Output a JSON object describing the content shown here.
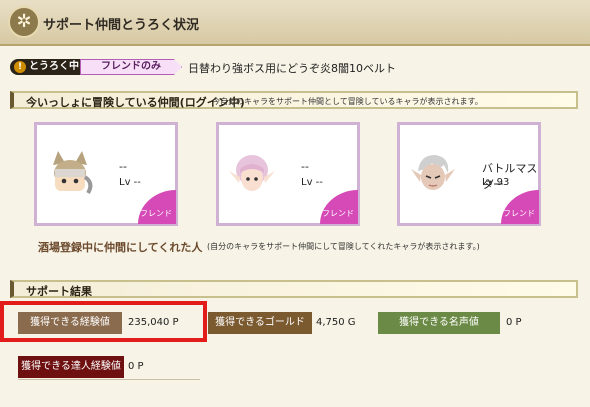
{
  "header": {
    "title": "サポート仲間とうろく状況"
  },
  "status": {
    "badge": "とうろく中",
    "badge_icon": "!",
    "friend_only": "フレンドのみ",
    "comment": "日替わり強ボス用にどうぞ炎8闇10ベルト"
  },
  "adventuring": {
    "title": "今いっしょに冒険している仲間(ログイン中)",
    "note": "今自分のキャラをサポート仲間として冒険しているキャラが表示されます。",
    "cards": [
      {
        "name": "--",
        "level": "Lv --",
        "tag": "フレンド"
      },
      {
        "name": "--",
        "level": "Lv --",
        "tag": "フレンド"
      },
      {
        "name": "バトルマスター",
        "level": "Lv 93",
        "tag": "フレンド"
      }
    ]
  },
  "bar": {
    "title": "酒場登録中に仲間にしてくれた人",
    "note": "(自分のキャラをサポート仲間にして冒険してくれたキャラが表示されます。)"
  },
  "results": {
    "title": "サポート結果",
    "exp_label": "獲得できる経験値",
    "exp_value": "235,040 P",
    "gold_label": "獲得できるゴールド",
    "gold_value": "4,750 G",
    "fame_label": "獲得できる名声値",
    "fame_value": "0 P",
    "master_label": "獲得できる達人経験値",
    "master_value": "0 P"
  }
}
